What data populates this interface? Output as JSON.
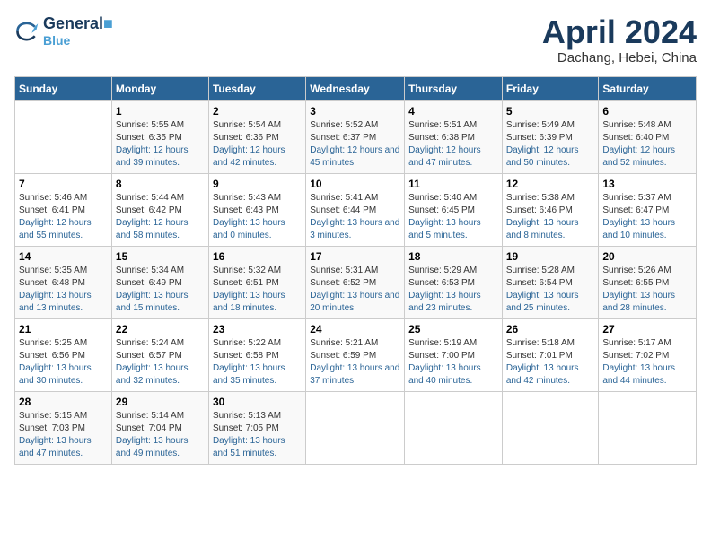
{
  "logo": {
    "line1": "General",
    "line2": "Blue"
  },
  "title": "April 2024",
  "subtitle": "Dachang, Hebei, China",
  "headers": [
    "Sunday",
    "Monday",
    "Tuesday",
    "Wednesday",
    "Thursday",
    "Friday",
    "Saturday"
  ],
  "weeks": [
    [
      {
        "num": "",
        "sunrise": "",
        "sunset": "",
        "daylight": ""
      },
      {
        "num": "1",
        "sunrise": "Sunrise: 5:55 AM",
        "sunset": "Sunset: 6:35 PM",
        "daylight": "Daylight: 12 hours and 39 minutes."
      },
      {
        "num": "2",
        "sunrise": "Sunrise: 5:54 AM",
        "sunset": "Sunset: 6:36 PM",
        "daylight": "Daylight: 12 hours and 42 minutes."
      },
      {
        "num": "3",
        "sunrise": "Sunrise: 5:52 AM",
        "sunset": "Sunset: 6:37 PM",
        "daylight": "Daylight: 12 hours and 45 minutes."
      },
      {
        "num": "4",
        "sunrise": "Sunrise: 5:51 AM",
        "sunset": "Sunset: 6:38 PM",
        "daylight": "Daylight: 12 hours and 47 minutes."
      },
      {
        "num": "5",
        "sunrise": "Sunrise: 5:49 AM",
        "sunset": "Sunset: 6:39 PM",
        "daylight": "Daylight: 12 hours and 50 minutes."
      },
      {
        "num": "6",
        "sunrise": "Sunrise: 5:48 AM",
        "sunset": "Sunset: 6:40 PM",
        "daylight": "Daylight: 12 hours and 52 minutes."
      }
    ],
    [
      {
        "num": "7",
        "sunrise": "Sunrise: 5:46 AM",
        "sunset": "Sunset: 6:41 PM",
        "daylight": "Daylight: 12 hours and 55 minutes."
      },
      {
        "num": "8",
        "sunrise": "Sunrise: 5:44 AM",
        "sunset": "Sunset: 6:42 PM",
        "daylight": "Daylight: 12 hours and 58 minutes."
      },
      {
        "num": "9",
        "sunrise": "Sunrise: 5:43 AM",
        "sunset": "Sunset: 6:43 PM",
        "daylight": "Daylight: 13 hours and 0 minutes."
      },
      {
        "num": "10",
        "sunrise": "Sunrise: 5:41 AM",
        "sunset": "Sunset: 6:44 PM",
        "daylight": "Daylight: 13 hours and 3 minutes."
      },
      {
        "num": "11",
        "sunrise": "Sunrise: 5:40 AM",
        "sunset": "Sunset: 6:45 PM",
        "daylight": "Daylight: 13 hours and 5 minutes."
      },
      {
        "num": "12",
        "sunrise": "Sunrise: 5:38 AM",
        "sunset": "Sunset: 6:46 PM",
        "daylight": "Daylight: 13 hours and 8 minutes."
      },
      {
        "num": "13",
        "sunrise": "Sunrise: 5:37 AM",
        "sunset": "Sunset: 6:47 PM",
        "daylight": "Daylight: 13 hours and 10 minutes."
      }
    ],
    [
      {
        "num": "14",
        "sunrise": "Sunrise: 5:35 AM",
        "sunset": "Sunset: 6:48 PM",
        "daylight": "Daylight: 13 hours and 13 minutes."
      },
      {
        "num": "15",
        "sunrise": "Sunrise: 5:34 AM",
        "sunset": "Sunset: 6:49 PM",
        "daylight": "Daylight: 13 hours and 15 minutes."
      },
      {
        "num": "16",
        "sunrise": "Sunrise: 5:32 AM",
        "sunset": "Sunset: 6:51 PM",
        "daylight": "Daylight: 13 hours and 18 minutes."
      },
      {
        "num": "17",
        "sunrise": "Sunrise: 5:31 AM",
        "sunset": "Sunset: 6:52 PM",
        "daylight": "Daylight: 13 hours and 20 minutes."
      },
      {
        "num": "18",
        "sunrise": "Sunrise: 5:29 AM",
        "sunset": "Sunset: 6:53 PM",
        "daylight": "Daylight: 13 hours and 23 minutes."
      },
      {
        "num": "19",
        "sunrise": "Sunrise: 5:28 AM",
        "sunset": "Sunset: 6:54 PM",
        "daylight": "Daylight: 13 hours and 25 minutes."
      },
      {
        "num": "20",
        "sunrise": "Sunrise: 5:26 AM",
        "sunset": "Sunset: 6:55 PM",
        "daylight": "Daylight: 13 hours and 28 minutes."
      }
    ],
    [
      {
        "num": "21",
        "sunrise": "Sunrise: 5:25 AM",
        "sunset": "Sunset: 6:56 PM",
        "daylight": "Daylight: 13 hours and 30 minutes."
      },
      {
        "num": "22",
        "sunrise": "Sunrise: 5:24 AM",
        "sunset": "Sunset: 6:57 PM",
        "daylight": "Daylight: 13 hours and 32 minutes."
      },
      {
        "num": "23",
        "sunrise": "Sunrise: 5:22 AM",
        "sunset": "Sunset: 6:58 PM",
        "daylight": "Daylight: 13 hours and 35 minutes."
      },
      {
        "num": "24",
        "sunrise": "Sunrise: 5:21 AM",
        "sunset": "Sunset: 6:59 PM",
        "daylight": "Daylight: 13 hours and 37 minutes."
      },
      {
        "num": "25",
        "sunrise": "Sunrise: 5:19 AM",
        "sunset": "Sunset: 7:00 PM",
        "daylight": "Daylight: 13 hours and 40 minutes."
      },
      {
        "num": "26",
        "sunrise": "Sunrise: 5:18 AM",
        "sunset": "Sunset: 7:01 PM",
        "daylight": "Daylight: 13 hours and 42 minutes."
      },
      {
        "num": "27",
        "sunrise": "Sunrise: 5:17 AM",
        "sunset": "Sunset: 7:02 PM",
        "daylight": "Daylight: 13 hours and 44 minutes."
      }
    ],
    [
      {
        "num": "28",
        "sunrise": "Sunrise: 5:15 AM",
        "sunset": "Sunset: 7:03 PM",
        "daylight": "Daylight: 13 hours and 47 minutes."
      },
      {
        "num": "29",
        "sunrise": "Sunrise: 5:14 AM",
        "sunset": "Sunset: 7:04 PM",
        "daylight": "Daylight: 13 hours and 49 minutes."
      },
      {
        "num": "30",
        "sunrise": "Sunrise: 5:13 AM",
        "sunset": "Sunset: 7:05 PM",
        "daylight": "Daylight: 13 hours and 51 minutes."
      },
      {
        "num": "",
        "sunrise": "",
        "sunset": "",
        "daylight": ""
      },
      {
        "num": "",
        "sunrise": "",
        "sunset": "",
        "daylight": ""
      },
      {
        "num": "",
        "sunrise": "",
        "sunset": "",
        "daylight": ""
      },
      {
        "num": "",
        "sunrise": "",
        "sunset": "",
        "daylight": ""
      }
    ]
  ]
}
